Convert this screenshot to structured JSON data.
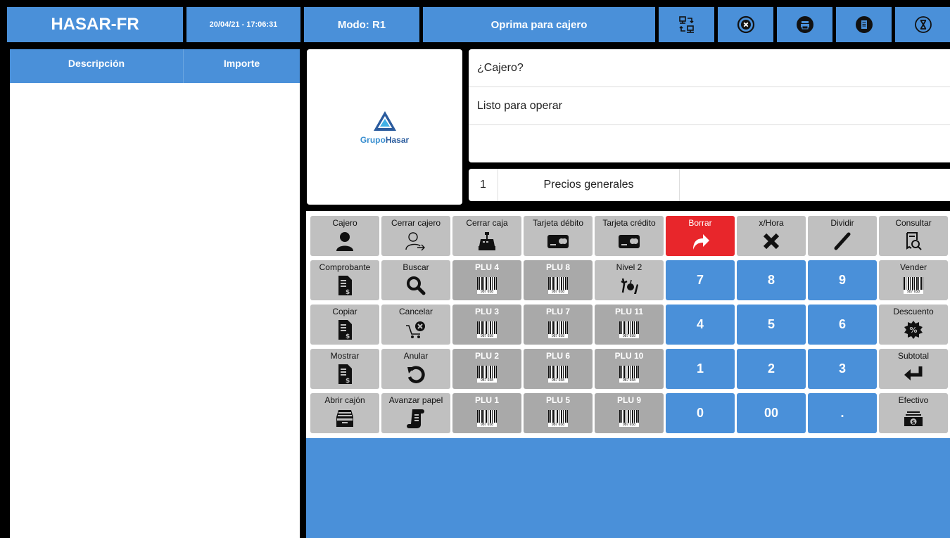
{
  "header": {
    "title": "HASAR-FR",
    "datetime": "20/04/21 - 17:06:31",
    "mode": "Modo: R1",
    "message": "Oprima para cajero",
    "icons": [
      "transfer-icon",
      "close-circle-icon",
      "printer-icon",
      "document-icon",
      "hourglass-icon"
    ]
  },
  "table": {
    "columns": [
      "Descripción",
      "Importe"
    ],
    "rows": []
  },
  "logo": {
    "brand_a": "Grupo",
    "brand_b": "Hasar"
  },
  "display": {
    "line1": "¿Cajero?",
    "line2": "Listo para operar",
    "line3": ""
  },
  "price_list": {
    "number": "1",
    "label": "Precios generales"
  },
  "keys": {
    "cajero": "Cajero",
    "cerrar_cajero": "Cerrar cajero",
    "cerrar_caja": "Cerrar caja",
    "tarjeta_debito": "Tarjeta débito",
    "tarjeta_credito": "Tarjeta crédito",
    "borrar": "Borrar",
    "x_hora": "x/Hora",
    "dividir": "Dividir",
    "consultar": "Consultar",
    "comprobante": "Comprobante",
    "buscar": "Buscar",
    "plu4": "PLU 4",
    "plu8": "PLU 8",
    "nivel2": "Nivel 2",
    "vender": "Vender",
    "copiar": "Copiar",
    "cancelar": "Cancelar",
    "plu3": "PLU 3",
    "plu7": "PLU 7",
    "plu11": "PLU 11",
    "descuento": "Descuento",
    "mostrar": "Mostrar",
    "anular": "Anular",
    "plu2": "PLU 2",
    "plu6": "PLU 6",
    "plu10": "PLU 10",
    "subtotal": "Subtotal",
    "abrir_cajon": "Abrir cajón",
    "avanzar_papel": "Avanzar papel",
    "plu1": "PLU 1",
    "plu5": "PLU 5",
    "plu9": "PLU 9",
    "efectivo": "Efectivo",
    "n7": "7",
    "n8": "8",
    "n9": "9",
    "n4": "4",
    "n5": "5",
    "n6": "6",
    "n1": "1",
    "n2": "2",
    "n3": "3",
    "n0": "0",
    "n00": "00",
    "dot": "."
  },
  "barcode_number": "987 658",
  "colors": {
    "accent": "#4a90d9",
    "danger": "#e8262b",
    "key_gray": "#c0c0c0",
    "plu_gray": "#a9a9a9"
  }
}
